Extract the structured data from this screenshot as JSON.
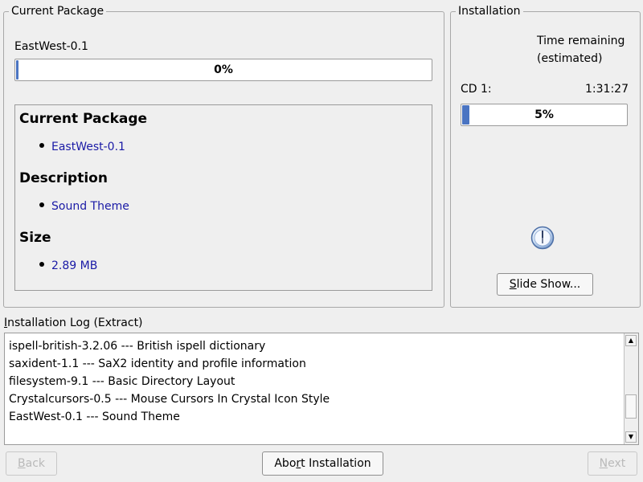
{
  "current_package_group": {
    "title": "Current Package",
    "package_name": "EastWest-0.1",
    "progress_percent": 0,
    "progress_label": "0%",
    "details": {
      "current_package_heading": "Current Package",
      "current_package_value": "EastWest-0.1",
      "description_heading": "Description",
      "description_value": "Sound Theme",
      "size_heading": "Size",
      "size_value": "2.89 MB"
    }
  },
  "installation_group": {
    "title": "Installation",
    "time_remaining_line1": "Time remaining",
    "time_remaining_line2": "(estimated)",
    "cd_label": "CD 1:",
    "cd_time": "1:31:27",
    "progress_percent": 5,
    "progress_label": "5%",
    "slideshow_label_first": "S",
    "slideshow_label_rest": "lide Show..."
  },
  "log": {
    "label_first": "I",
    "label_rest": "nstallation Log (Extract)",
    "lines": [
      "ispell-british-3.2.06 --- British ispell dictionary",
      "saxident-1.1 --- SaX2 identity and profile information",
      "filesystem-9.1 --- Basic Directory Layout",
      "Crystalcursors-0.5 --- Mouse Cursors In Crystal Icon Style",
      "EastWest-0.1 --- Sound Theme"
    ]
  },
  "footer": {
    "back_first": "B",
    "back_rest": "ack",
    "abort_before": "Abo",
    "abort_underline": "r",
    "abort_after": "t Installation",
    "next_first": "N",
    "next_rest": "ext"
  },
  "colors": {
    "progress_fill": "#4a74c2",
    "link_text": "#1a1aa6"
  },
  "icons": {
    "clock": "clock-icon"
  }
}
